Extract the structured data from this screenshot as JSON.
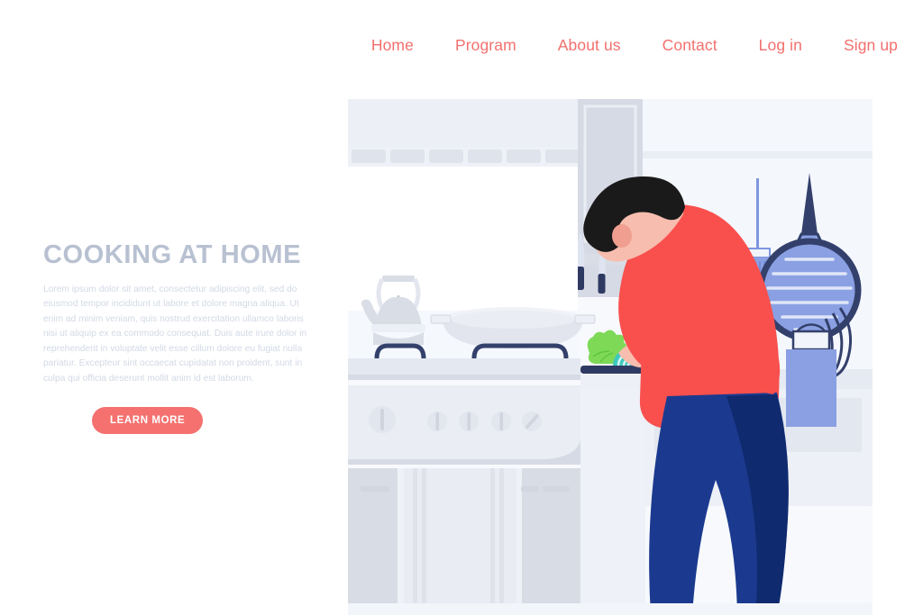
{
  "nav": {
    "items": [
      {
        "label": "Home",
        "name": "nav-item-home"
      },
      {
        "label": "Program",
        "name": "nav-item-program"
      },
      {
        "label": "About us",
        "name": "nav-item-about-us"
      },
      {
        "label": "Contact",
        "name": "nav-item-contact"
      },
      {
        "label": "Log in",
        "name": "nav-item-log-in"
      },
      {
        "label": "Sign up",
        "name": "nav-item-sign-up"
      }
    ],
    "link_color": "#f2706e"
  },
  "hero": {
    "title": "COOKING AT HOME",
    "title_color": "#b8c1d1",
    "body": "Lorem ipsum dolor sit amet, consectetur adipiscing elit, sed do eiusmod tempor incididunt ut labore et dolore magna aliqua. Ut enim ad minim veniam, quis nostrud exercitation ullamco laboris nisi ut aliquip ex ea commodo consequat. Duis aute irure dolor in reprehenderit in voluptate velit esse cillum dolore eu fugiat nulla pariatur. Excepteur sint occaecat cupidatat non proident, sunt in culpa qui officia deserunt mollit anim id est laborum.",
    "body_color": "#d2d9e5",
    "cta_label": "LEARN MORE",
    "cta_bg": "#f4716f",
    "cta_text_color": "#ffffff"
  },
  "illustration": {
    "alt": "Flat illustration of a man cooking in a kitchen, chopping lettuce on a cutting board beside a stove with a kettle and frying pan",
    "colors": {
      "panel_bg": "#f6f8fc",
      "wall_light": "#eef1f7",
      "cabinet_grey": "#d7dbe4",
      "cabinet_light": "#e8ebf2",
      "counter": "#eaedf4",
      "shirt_red": "#f9504e",
      "shirt_red_shadow": "#ef4744",
      "pants_navy": "#1b3a8f",
      "pants_navy_dark": "#0f2a6e",
      "hair_black": "#1a1a1a",
      "skin": "#f7bdae",
      "skin_shadow": "#f09e8f",
      "utensil_blue": "#7e96e0",
      "outline_navy": "#33406b",
      "lettuce_green": "#7ed957",
      "cabbage_teal": "#3ec9c0"
    },
    "elements": [
      "upper-cabinets",
      "cabinet-door-panels",
      "wall-shelf",
      "bottle-large",
      "bottle-small",
      "tall-wall-cabinet",
      "knife-rail",
      "knife-large",
      "knife-small",
      "kettle",
      "frying-pan",
      "burner-grate-left",
      "burner-grate-right",
      "stove-body",
      "stove-knobs",
      "oven-door",
      "lower-cabinets",
      "drawer-handles",
      "countertop",
      "cutting-board",
      "lettuce",
      "cabbage",
      "hanging-brush",
      "hanging-strainer",
      "utensil-holder",
      "whisk",
      "person-head",
      "person-hair",
      "person-ear",
      "person-arm",
      "person-hand",
      "person-shirt",
      "person-pants"
    ]
  }
}
